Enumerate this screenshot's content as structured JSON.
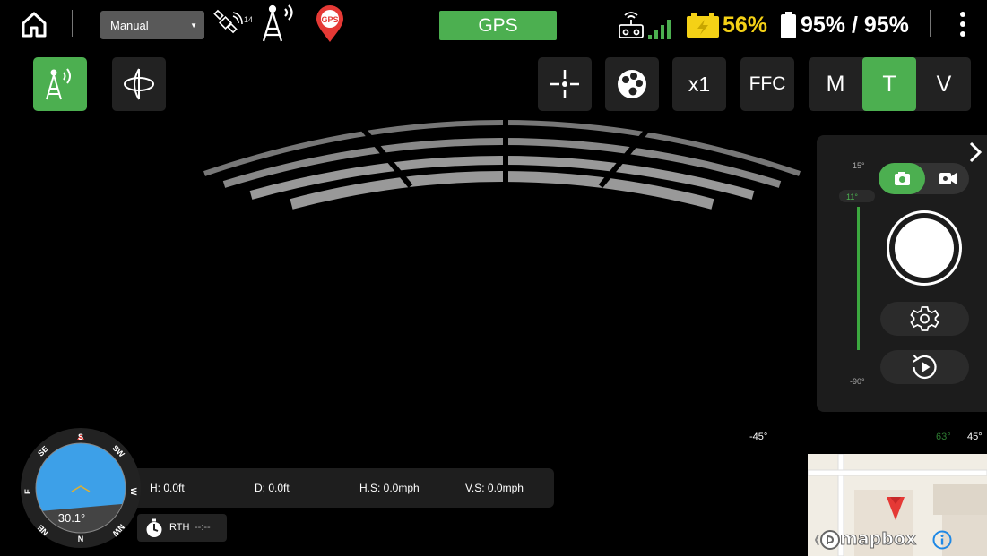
{
  "topbar": {
    "flight_mode": "Manual",
    "satellite_count": "14",
    "gps_label": "GPS",
    "gps_pin_label": "GPS",
    "drone_battery": "56%",
    "rc_battery": "95% / 95%"
  },
  "toolbar": {
    "zoom": "x1",
    "ffc": "FFC",
    "modes": [
      "M",
      "T",
      "V"
    ],
    "active_mode": "T"
  },
  "camera_panel": {
    "pitch_top": "15°",
    "pitch_current": "11°",
    "pitch_bottom": "-90°",
    "capture_mode": "photo"
  },
  "gimbal": {
    "angle_left": "-45°",
    "angle_right_dim": "63°",
    "angle_right": "45°"
  },
  "telemetry": {
    "height": "H: 0.0ft",
    "distance": "D: 0.0ft",
    "h_speed": "H.S: 0.0mph",
    "v_speed": "V.S: 0.0mph",
    "rth_label": "RTH",
    "rth_time": "--:--"
  },
  "compass": {
    "heading": "30.1°",
    "labels": [
      "S",
      "SW",
      "W",
      "NW",
      "N",
      "NE",
      "E",
      "SE"
    ]
  },
  "map": {
    "provider": "mapbox"
  },
  "colors": {
    "accent": "#4caf50",
    "battery_yellow": "#f4d116",
    "gps_red": "#e53935",
    "sky_blue": "#3da0e8"
  }
}
